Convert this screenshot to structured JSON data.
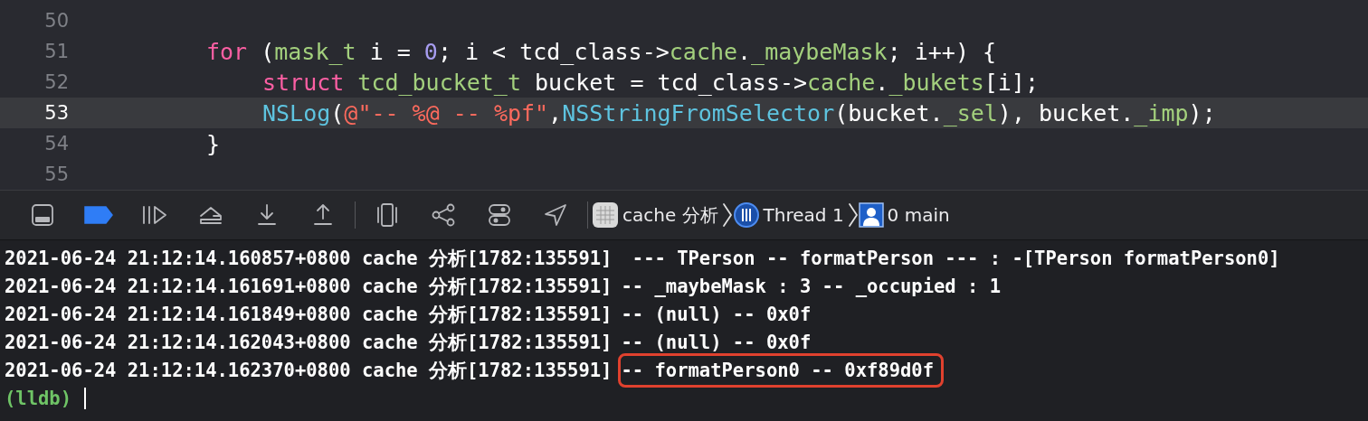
{
  "editor": {
    "lines": [
      {
        "number": "50",
        "selected": false
      },
      {
        "number": "51",
        "selected": false,
        "tokens": [
          {
            "kind": "keyword",
            "text": "for"
          },
          {
            "kind": "plain",
            "text": " ("
          },
          {
            "kind": "type",
            "text": "mask_t"
          },
          {
            "kind": "plain",
            "text": " i = "
          },
          {
            "kind": "number",
            "text": "0"
          },
          {
            "kind": "plain",
            "text": "; i < tcd_class->"
          },
          {
            "kind": "type",
            "text": "cache"
          },
          {
            "kind": "plain",
            "text": "."
          },
          {
            "kind": "type",
            "text": "_maybeMask"
          },
          {
            "kind": "plain",
            "text": "; i++) {"
          }
        ],
        "children": [
          {
            "number": "52",
            "selected": false,
            "tokens": [
              {
                "kind": "keyword",
                "text": "struct "
              },
              {
                "kind": "type",
                "text": "tcd_bucket_t"
              },
              {
                "kind": "plain",
                "text": " bucket = tcd_class->"
              },
              {
                "kind": "type",
                "text": "cache"
              },
              {
                "kind": "plain",
                "text": "."
              },
              {
                "kind": "type",
                "text": "_bukets"
              },
              {
                "kind": "plain",
                "text": "[i];"
              }
            ]
          },
          {
            "number": "53",
            "selected": true,
            "tokens": [
              {
                "kind": "function",
                "text": "NSLog"
              },
              {
                "kind": "plain",
                "text": "("
              },
              {
                "kind": "string",
                "text": "@\"-- %@ -- %pf\""
              },
              {
                "kind": "plain",
                "text": ","
              },
              {
                "kind": "function",
                "text": "NSStringFromSelector"
              },
              {
                "kind": "plain",
                "text": "(bucket."
              },
              {
                "kind": "type",
                "text": "_sel"
              },
              {
                "kind": "plain",
                "text": "), bucket."
              },
              {
                "kind": "type",
                "text": "_imp"
              },
              {
                "kind": "plain",
                "text": ");"
              }
            ]
          }
        ]
      },
      {
        "number": "54",
        "selected": false,
        "tokens": [
          {
            "kind": "plain",
            "text": "}"
          }
        ]
      },
      {
        "number": "55",
        "selected": false
      }
    ]
  },
  "debug_bar": {
    "breakpoints_active": true,
    "breadcrumbs": [
      {
        "kind": "target",
        "label": "cache 分析"
      },
      {
        "kind": "thread",
        "label": "Thread 1"
      },
      {
        "kind": "frame",
        "label": "0 main"
      }
    ]
  },
  "console": {
    "lines": [
      {
        "prefix": "2021-06-24 21:12:14.160857+0800 cache 分析[1782:135591]",
        "message": " --- TPerson -- formatPerson --- : -[TPerson formatPerson0]",
        "boxed": false
      },
      {
        "prefix": "2021-06-24 21:12:14.161691+0800 cache 分析[1782:135591]",
        "message": "-- _maybeMask : 3 -- _occupied : 1",
        "boxed": false
      },
      {
        "prefix": "2021-06-24 21:12:14.161849+0800 cache 分析[1782:135591]",
        "message": "-- (null) -- 0x0f",
        "boxed": false
      },
      {
        "prefix": "2021-06-24 21:12:14.162043+0800 cache 分析[1782:135591]",
        "message": "-- (null) -- 0x0f",
        "boxed": false
      },
      {
        "prefix": "2021-06-24 21:12:14.162370+0800 cache 分析[1782:135591]",
        "message": "-- formatPerson0 -- 0xf89d0f",
        "boxed": true
      }
    ],
    "prompt": "(lldb)"
  }
}
